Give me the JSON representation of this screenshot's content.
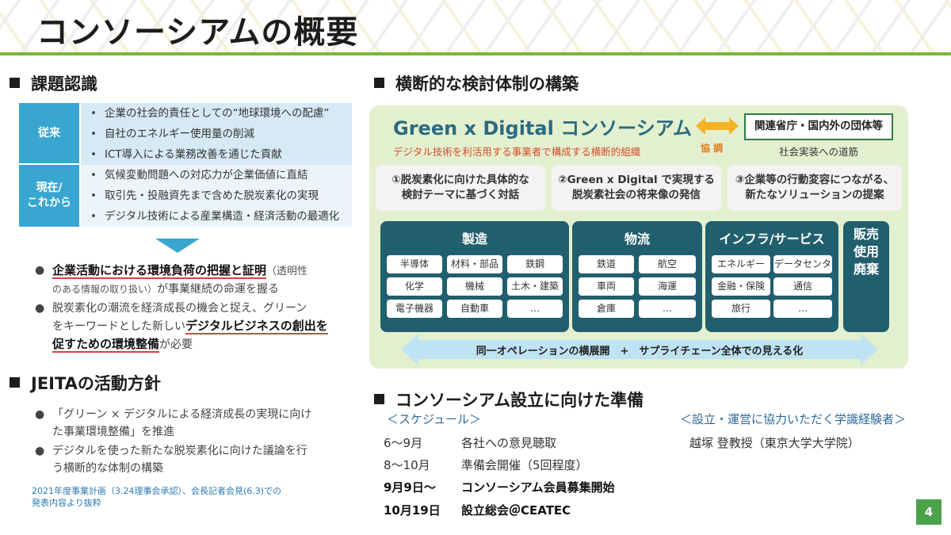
{
  "title": "コンソーシアムの概要",
  "left": {
    "section1": "課題認識",
    "rows": [
      {
        "label": "従来",
        "items": [
          "企業の社会的責任としての“地球環境への配慮”",
          "自社のエネルギー使用量の削減",
          "ICT導入による業務改善を通じた貢献"
        ]
      },
      {
        "label1": "現在/",
        "label2": "これから",
        "items": [
          "気候変動問題への対応力が企業価値に直結",
          "取引先・投融資先まで含めた脱炭素化の実現",
          "デジタル技術による産業構造・経済活動の最適化"
        ]
      }
    ],
    "bullet1": {
      "u": "企業活動における環境負荷の把握と証明",
      "paren": "（透明性",
      "line2_small": "のある情報の取り扱い）",
      "line2_rest": "が事業継続の命運を握る"
    },
    "bullet2": {
      "l1": "脱炭素化の潮流を経済成長の機会と捉え、グリーン",
      "l2a": "をキーワードとした新しい",
      "l2u": "デジタルビジネスの創出を",
      "l3u": "促すための環境整備",
      "l3b": "が必要"
    },
    "section2": "JEITAの活動方針",
    "bullet3": {
      "l1": "「グリーン × デジタルによる経済成長の実現に向け",
      "l2": "た事業環境整備」を推進"
    },
    "bullet4": {
      "l1": "デジタルを使った新たな脱炭素化に向けた議論を行",
      "l2": "う横断的な体制の構築"
    },
    "note1": "2021年度事業計画（3.24理事会承認）、会長記者会見(6.3)での",
    "note2": "発表内容より抜粋"
  },
  "right": {
    "section1": "横断的な検討体制の構築",
    "gx_title": "Green x Digital コンソーシアム",
    "gx_sub": "デジタル技術を利活用する事業者で構成する横断的組織",
    "kyocho": "協 調",
    "partner": "関連省庁・国内外の団体等",
    "partner_sub": "社会実装への道筋",
    "themes": [
      {
        "l1": "①脱炭素化に向けた具体的な",
        "l2": "検討テーマに基づく対話"
      },
      {
        "l1": "②Green x Digital で実現する",
        "l2": "脱炭素社会の将来像の発信"
      },
      {
        "l1": "③企業等の行動変容につながる、",
        "l2": "新たなソリューションの提案"
      }
    ],
    "blocks": [
      {
        "title": "製造",
        "items": [
          "半導体",
          "材料・部品",
          "鉄鋼",
          "化学",
          "機械",
          "土木・建築",
          "電子機器",
          "自動車",
          "…"
        ]
      },
      {
        "title": "物流",
        "items": [
          "鉄道",
          "航空",
          "車両",
          "海運",
          "倉庫",
          "…"
        ]
      },
      {
        "title": "インフラ/サービス",
        "items": [
          "エネルギー",
          "データセンタ",
          "金融・保険",
          "通信",
          "旅行",
          "…"
        ]
      }
    ],
    "sales": [
      "販売",
      "使用",
      "廃棄"
    ],
    "arrow_text": "同一オペレーションの横展開　+　サプライチェーン全体での見える化",
    "section2": "コンソーシアム設立に向けた準備",
    "schedule_label": "＜スケジュール＞",
    "schedule": [
      {
        "date": "6～9月",
        "text": "各社への意見聴取"
      },
      {
        "date": "8～10月",
        "text": "準備会開催（5回程度）"
      },
      {
        "date": "9月9日～",
        "text": "コンソーシアム会員募集開始"
      },
      {
        "date": "10月19日",
        "text": "設立総会＠CEATEC"
      }
    ],
    "expert_label": "＜設立・運営に協力いただく学識経験者＞",
    "expert": "越塚 登教授（東京大学大学院）"
  },
  "page_number": "4",
  "colors": {
    "accent_green": "#7cb63a",
    "label_blue": "#38a6d1",
    "block_teal": "#225f6e",
    "diagram_bg": "#e3f0cf",
    "title_blue": "#2b6a82",
    "red": "#d64b2b"
  }
}
